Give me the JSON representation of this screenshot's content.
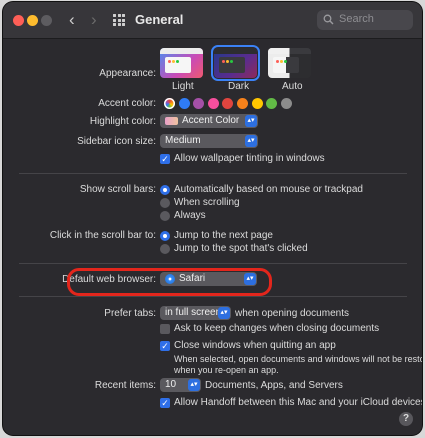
{
  "window": {
    "title": "General"
  },
  "search": {
    "placeholder": "Search"
  },
  "appearance": {
    "label": "Appearance:",
    "options": [
      {
        "label": "Light",
        "selected": false
      },
      {
        "label": "Dark",
        "selected": true
      },
      {
        "label": "Auto",
        "selected": false
      }
    ]
  },
  "accent": {
    "label": "Accent color:",
    "colors": [
      "#b9b9b9",
      "#2f7cf6",
      "#a550a7",
      "#f74f9e",
      "#e0453f",
      "#f7821b",
      "#ffc600",
      "#62ba46",
      "#8c8c8c"
    ]
  },
  "highlight": {
    "label": "Highlight color:",
    "value": "Accent Color"
  },
  "sidebar_icon_size": {
    "label": "Sidebar icon size:",
    "value": "Medium"
  },
  "wallpaper_tinting": {
    "label": "Allow wallpaper tinting in windows",
    "checked": true
  },
  "scroll_bars": {
    "label": "Show scroll bars:",
    "options": [
      {
        "label": "Automatically based on mouse or trackpad",
        "selected": true
      },
      {
        "label": "When scrolling",
        "selected": false
      },
      {
        "label": "Always",
        "selected": false
      }
    ]
  },
  "click_scroll": {
    "label": "Click in the scroll bar to:",
    "options": [
      {
        "label": "Jump to the next page",
        "selected": true
      },
      {
        "label": "Jump to the spot that's clicked",
        "selected": false
      }
    ]
  },
  "browser": {
    "label": "Default web browser:",
    "value": "Safari"
  },
  "prefer_tabs": {
    "label": "Prefer tabs:",
    "value": "in full screen",
    "suffix": "when opening documents"
  },
  "ask_keep_changes": {
    "label": "Ask to keep changes when closing documents",
    "checked": false
  },
  "close_windows": {
    "label": "Close windows when quitting an app",
    "checked": true,
    "note1": "When selected, open documents and windows will not be restored",
    "note2": "when you re-open an app."
  },
  "recent_items": {
    "label": "Recent items:",
    "value": "10",
    "suffix": "Documents, Apps, and Servers"
  },
  "handoff": {
    "label": "Allow Handoff between this Mac and your iCloud devices",
    "checked": true
  },
  "help": {
    "label": "?"
  }
}
